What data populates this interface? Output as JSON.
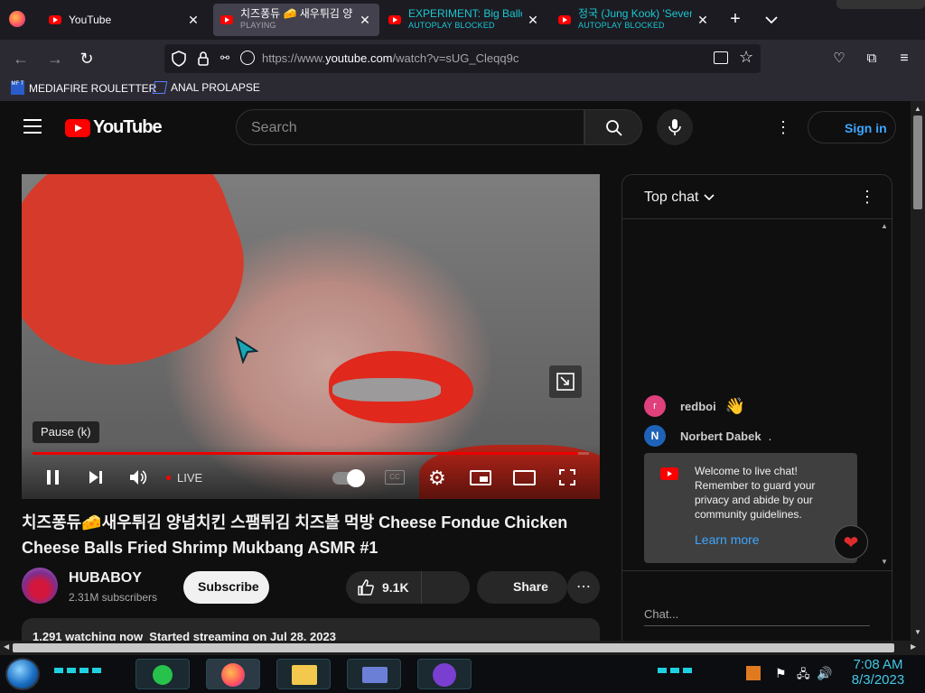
{
  "tabs": [
    {
      "title": "YouTube",
      "subtitle": ""
    },
    {
      "title": "치즈퐁듀 🧀 새우튀김 양",
      "subtitle": "PLAYING"
    },
    {
      "title": "EXPERIMENT: Big Balloo",
      "subtitle": "AUTOPLAY BLOCKED"
    },
    {
      "title": "정국 (Jung Kook) 'Seven",
      "subtitle": "AUTOPLAY BLOCKED"
    }
  ],
  "url": {
    "prefix": "https://www.",
    "main": "youtube.com",
    "rest": "/watch?v=sUG_Cleqq9c"
  },
  "bookmarks": [
    {
      "label": "MEDIAFIRE ROULETTER"
    },
    {
      "label": "ANAL PROLAPSE"
    }
  ],
  "youtube": {
    "logo": "YouTube",
    "search_placeholder": "Search",
    "sign_in": "Sign in"
  },
  "player": {
    "tooltip": "Pause (k)",
    "live_label": "LIVE",
    "progress": 0.98
  },
  "video": {
    "title": "치즈퐁듀🧀새우튀김 양념치킨 스팸튀김 치즈볼 먹방 Cheese Fondue Chicken Cheese Balls Fried Shrimp Mukbang ASMR #1",
    "channel": "HUBABOY",
    "subscribers": "2.31M subscribers",
    "subscribe_label": "Subscribe",
    "likes": "9.1K",
    "share_label": "Share",
    "description": "1,291 watching now  Started streaming on Jul 28, 2023"
  },
  "chat": {
    "header": "Top chat",
    "messages": [
      {
        "avatar": "r",
        "author": "redboi",
        "text": "👋",
        "avatar_color": "#e0407b"
      },
      {
        "avatar": "N",
        "author": "Norbert Dabek",
        "text": ".",
        "avatar_color": "#1e63b8"
      }
    ],
    "notice": "Welcome to live chat! Remember to guard your privacy and abide by our community guidelines.",
    "learn_more": "Learn more",
    "input_placeholder": "Chat..."
  },
  "taskbar": {
    "time": "7:08 AM",
    "date": "8/3/2023"
  },
  "colors": {
    "accent": "#3ea6ff",
    "red": "#ff0000"
  }
}
